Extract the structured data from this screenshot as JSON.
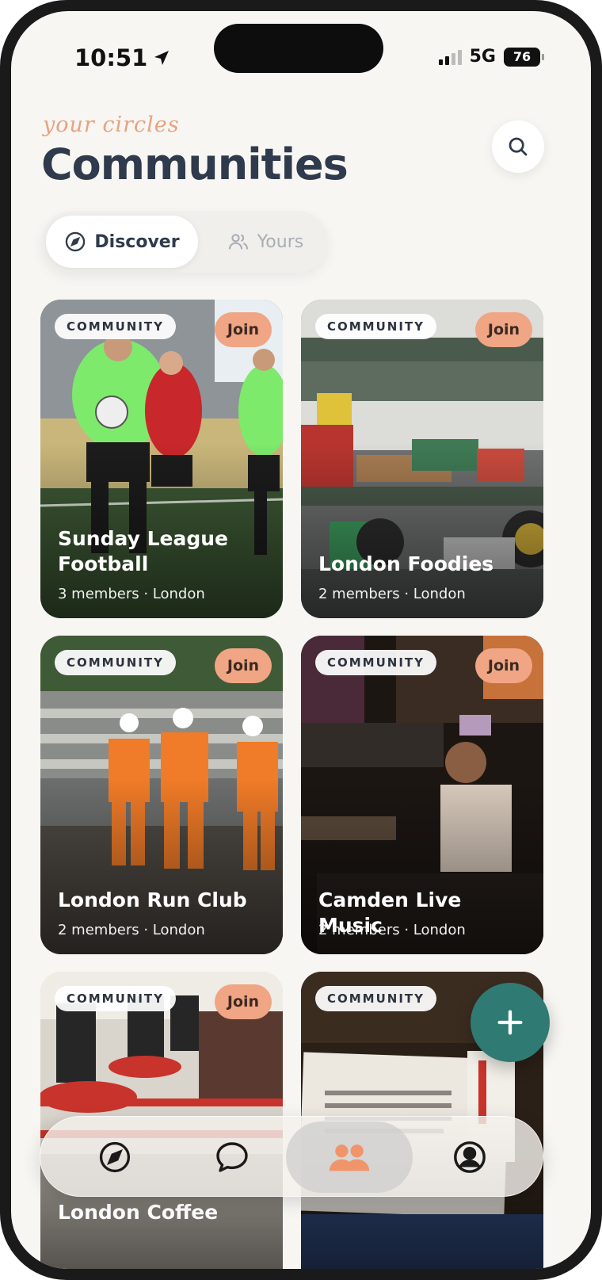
{
  "status_bar": {
    "time": "10:51",
    "network": "5G",
    "battery": "76"
  },
  "header": {
    "eyebrow": "your circles",
    "title": "Communities"
  },
  "tabs": [
    {
      "label": "Discover"
    },
    {
      "label": "Yours"
    }
  ],
  "communities": [
    {
      "badge": "COMMUNITY",
      "join": "Join",
      "title": "Sunday League Football",
      "meta": "3 members · London"
    },
    {
      "badge": "COMMUNITY",
      "join": "Join",
      "title": "London Foodies",
      "meta": "2 members · London"
    },
    {
      "badge": "COMMUNITY",
      "join": "Join",
      "title": "London Run Club",
      "meta": "2 members · London"
    },
    {
      "badge": "COMMUNITY",
      "join": "Join",
      "title": "Camden Live Music",
      "meta": "2 members · London"
    },
    {
      "badge": "COMMUNITY",
      "join": "Join",
      "title": "London Coffee",
      "meta": ""
    },
    {
      "badge": "COMMUNITY",
      "join": "",
      "title": "",
      "meta": ""
    }
  ],
  "bottom_nav": [
    "compass-icon",
    "chat-icon",
    "people-icon",
    "profile-icon"
  ],
  "colors": {
    "accent": "#f0a585",
    "fab": "#2f7a73",
    "title": "#2f3a4c",
    "eyebrow": "#e8a27f"
  }
}
